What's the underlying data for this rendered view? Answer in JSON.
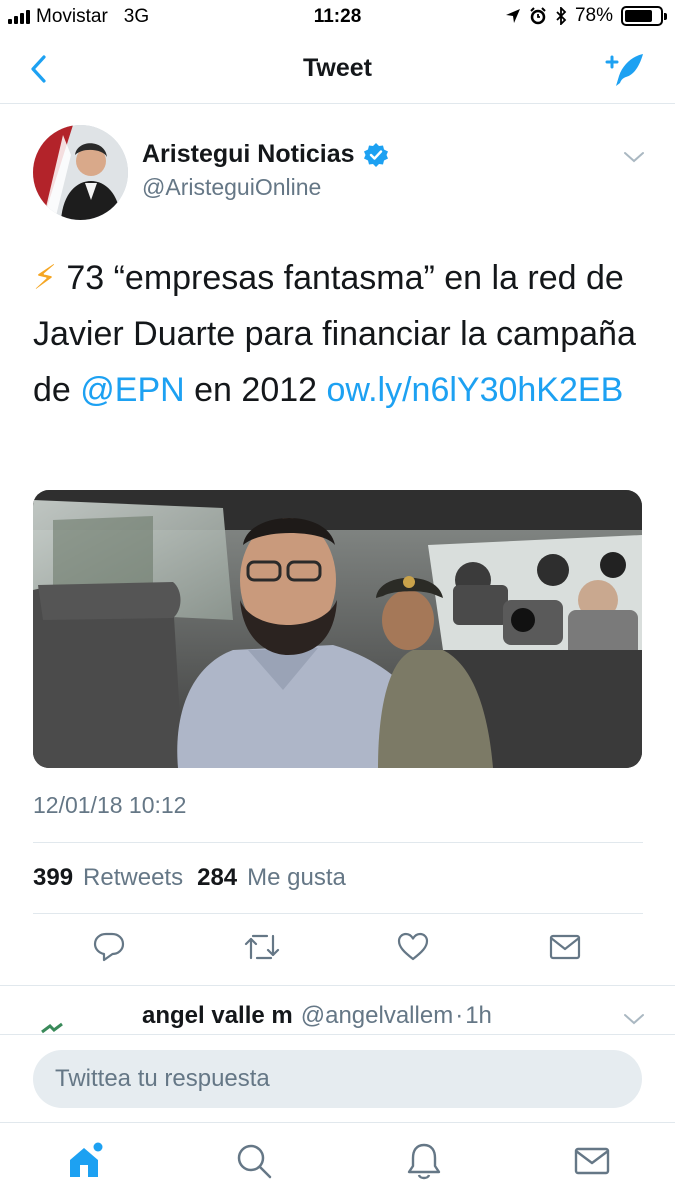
{
  "status_bar": {
    "carrier": "Movistar",
    "network": "3G",
    "time": "11:28",
    "battery_percent": "78%",
    "battery_level": 0.78
  },
  "nav": {
    "title": "Tweet",
    "back_icon": "chevron-left-icon",
    "compose_icon": "compose-tweet-icon"
  },
  "tweet": {
    "author_name": "Aristegui Noticias",
    "author_handle": "@AristeguiOnline",
    "verified": true,
    "text": {
      "emoji": "⚡",
      "part1": " 73 “empresas fantasma” en la red de Javier Duarte para financiar la campaña de ",
      "mention": "@EPN",
      "part2": " en 2012 ",
      "link": "ow.ly/n6lY30hK2EB"
    },
    "timestamp": "12/01/18 10:12",
    "retweets_count": "399",
    "retweets_label": "Retweets",
    "likes_count": "284",
    "likes_label": "Me gusta"
  },
  "reply_preview": {
    "name": "angel valle m",
    "handle": "@angelvallem",
    "separator": "·",
    "time": "1h"
  },
  "composer": {
    "placeholder": "Twittea tu respuesta"
  },
  "colors": {
    "accent": "#1da1f2",
    "secondary_text": "#657786",
    "primary_text": "#14171a",
    "divider": "#e1e8ed",
    "input_bg": "#e6ecf0"
  }
}
